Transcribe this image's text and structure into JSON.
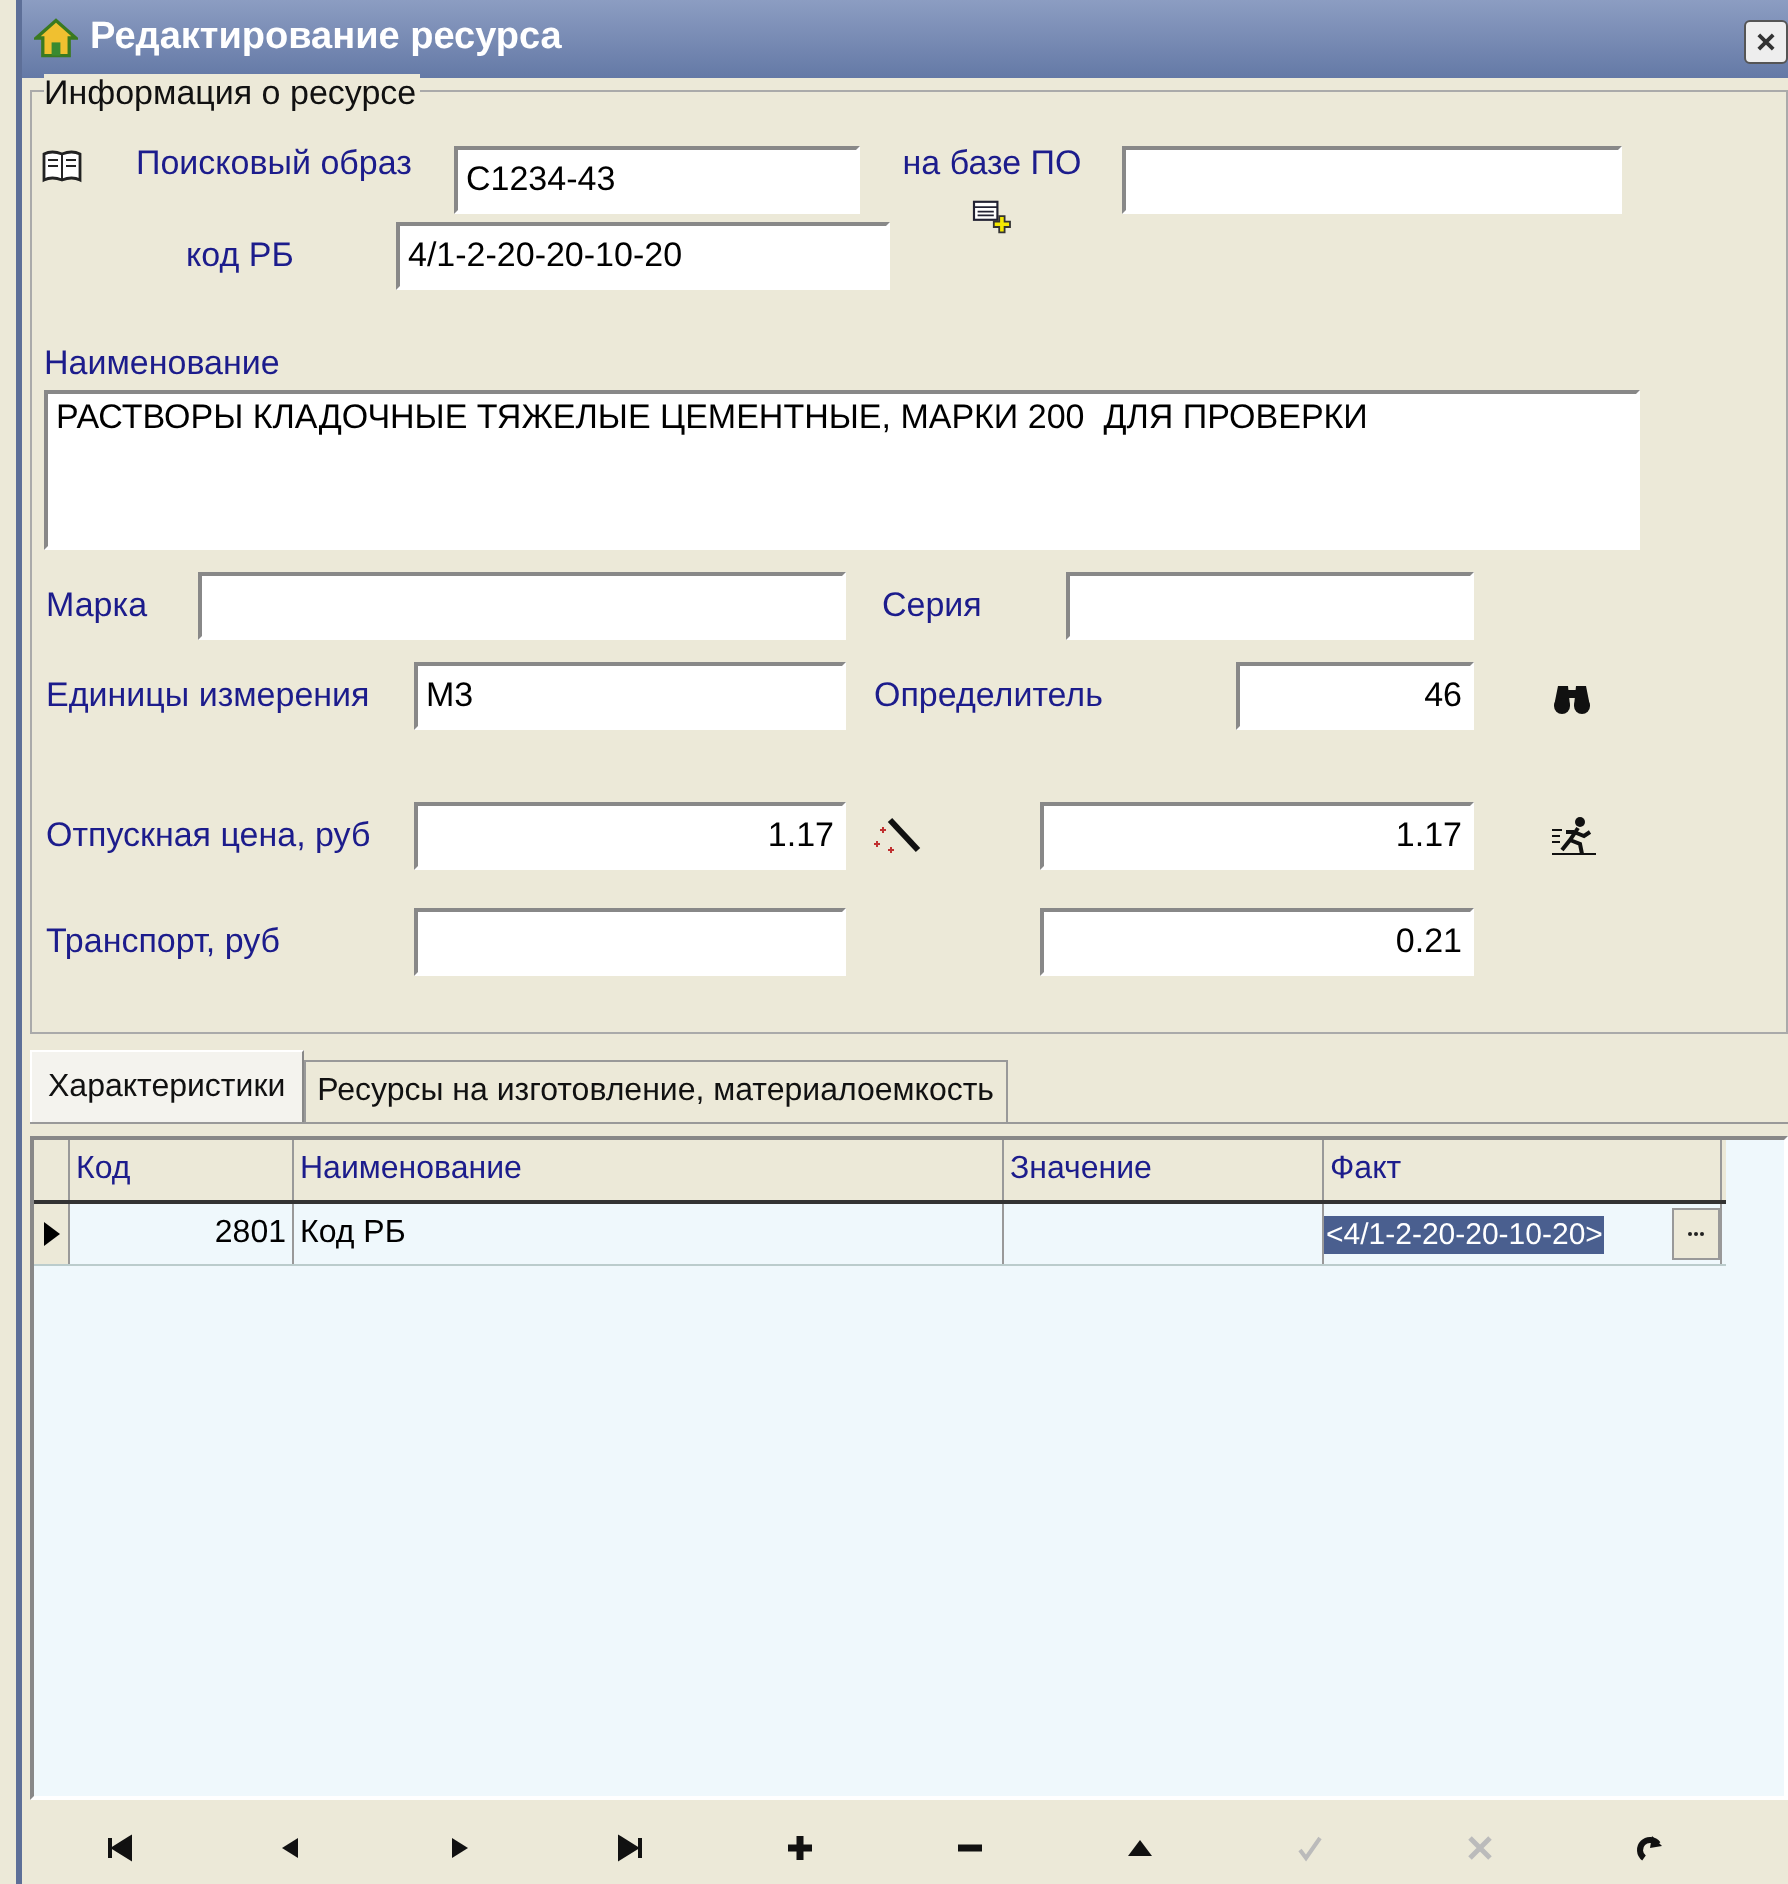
{
  "window": {
    "title": "Редактирование ресурса"
  },
  "group": {
    "title": "Информация о ресурсе"
  },
  "search_image": {
    "label": "Поисковый образ",
    "value": "C1234-43"
  },
  "based_on": {
    "label": "на базе ПО"
  },
  "rb_code": {
    "label": "код РБ",
    "value": "4/1-2-20-20-10-20"
  },
  "name": {
    "label": "Наименование",
    "value": "РАСТВОРЫ КЛАДОЧНЫЕ ТЯЖЕЛЫЕ ЦЕМЕНТНЫЕ, МАРКИ 200  ДЛЯ ПРОВЕРКИ"
  },
  "brand": {
    "label": "Марка"
  },
  "series": {
    "label": "Серия"
  },
  "units": {
    "label": "Единицы измерения",
    "value": "М3"
  },
  "determinant": {
    "label": "Определитель",
    "value": "46"
  },
  "price": {
    "label": "Отпускная цена, руб",
    "value": "1.17",
    "value_2": "1.17"
  },
  "transport": {
    "label": "Транспорт, руб",
    "value_2": "0.21"
  },
  "tabs": [
    {
      "label": "Характеристики",
      "selected": true
    },
    {
      "label": "Ресурсы на изготовление, материалоемкость",
      "selected": false
    }
  ],
  "table": {
    "columns": [
      "Код",
      "Наименование",
      "Значение",
      "Факт"
    ],
    "rows": [
      {
        "code": "2801",
        "name": "Код РБ",
        "fact": "<4/1-2-20-20-10-20>",
        "selected": true
      }
    ]
  },
  "navigator": [
    {
      "kind": "first",
      "disabled": false
    },
    {
      "kind": "prior",
      "disabled": false
    },
    {
      "kind": "next",
      "disabled": false
    },
    {
      "kind": "last",
      "disabled": false
    },
    {
      "kind": "insert",
      "disabled": false
    },
    {
      "kind": "delete",
      "disabled": false
    },
    {
      "kind": "edit",
      "disabled": false
    },
    {
      "kind": "post",
      "disabled": true
    },
    {
      "kind": "cancel",
      "disabled": true
    },
    {
      "kind": "refresh",
      "disabled": false
    }
  ]
}
